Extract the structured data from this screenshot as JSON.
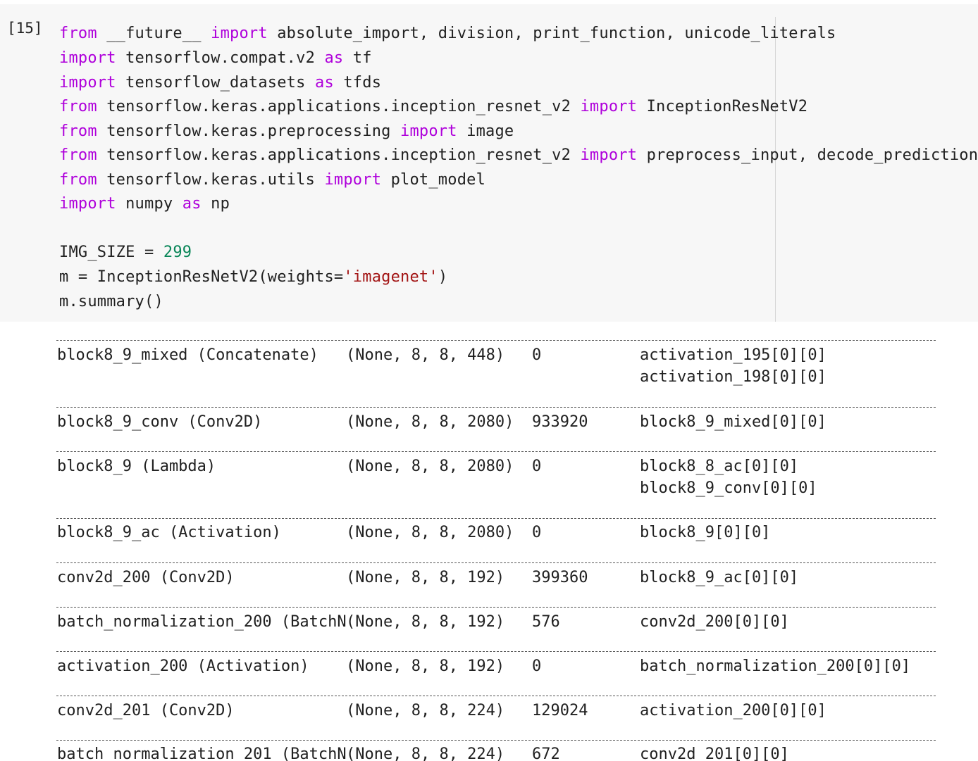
{
  "cell": {
    "execution_count": "[15]",
    "code_lines": [
      [
        {
          "t": "from",
          "c": "kw"
        },
        {
          "t": " __future__ ",
          "c": "plain"
        },
        {
          "t": "import",
          "c": "kw"
        },
        {
          "t": " absolute_import, division, print_function, unicode_literals",
          "c": "plain"
        }
      ],
      [
        {
          "t": "import",
          "c": "kw"
        },
        {
          "t": " tensorflow.compat.v2 ",
          "c": "plain"
        },
        {
          "t": "as",
          "c": "kw"
        },
        {
          "t": " tf",
          "c": "plain"
        }
      ],
      [
        {
          "t": "import",
          "c": "kw"
        },
        {
          "t": " tensorflow_datasets ",
          "c": "plain"
        },
        {
          "t": "as",
          "c": "kw"
        },
        {
          "t": " tfds",
          "c": "plain"
        }
      ],
      [
        {
          "t": "from",
          "c": "kw"
        },
        {
          "t": " tensorflow.keras.applications.inception_resnet_v2 ",
          "c": "plain"
        },
        {
          "t": "import",
          "c": "kw"
        },
        {
          "t": " InceptionResNetV2",
          "c": "plain"
        }
      ],
      [
        {
          "t": "from",
          "c": "kw"
        },
        {
          "t": " tensorflow.keras.preprocessing ",
          "c": "plain"
        },
        {
          "t": "import",
          "c": "kw"
        },
        {
          "t": " image",
          "c": "plain"
        }
      ],
      [
        {
          "t": "from",
          "c": "kw"
        },
        {
          "t": " tensorflow.keras.applications.inception_resnet_v2 ",
          "c": "plain"
        },
        {
          "t": "import",
          "c": "kw"
        },
        {
          "t": " preprocess_input, decode_predictions",
          "c": "plain"
        }
      ],
      [
        {
          "t": "from",
          "c": "kw"
        },
        {
          "t": " tensorflow.keras.utils ",
          "c": "plain"
        },
        {
          "t": "import",
          "c": "kw"
        },
        {
          "t": " plot_model",
          "c": "plain"
        }
      ],
      [
        {
          "t": "import",
          "c": "kw"
        },
        {
          "t": " numpy ",
          "c": "plain"
        },
        {
          "t": "as",
          "c": "kw"
        },
        {
          "t": " np",
          "c": "plain"
        }
      ],
      [],
      [
        {
          "t": "IMG_SIZE = ",
          "c": "plain"
        },
        {
          "t": "299",
          "c": "num"
        }
      ],
      [
        {
          "t": "m = InceptionResNetV2(weights=",
          "c": "plain"
        },
        {
          "t": "'imagenet'",
          "c": "str"
        },
        {
          "t": ")",
          "c": "plain"
        }
      ],
      [
        {
          "t": "m.summary()",
          "c": "plain"
        }
      ]
    ]
  },
  "output": {
    "rows": [
      {
        "layer": "block8_9_mixed (Concatenate)",
        "shape": "(None, 8, 8, 448)",
        "params": "0",
        "connected": [
          "activation_195[0][0]",
          "activation_198[0][0]"
        ]
      },
      {
        "layer": "block8_9_conv (Conv2D)",
        "shape": "(None, 8, 8, 2080)",
        "params": "933920",
        "connected": [
          "block8_9_mixed[0][0]"
        ]
      },
      {
        "layer": "block8_9 (Lambda)",
        "shape": "(None, 8, 8, 2080)",
        "params": "0",
        "connected": [
          "block8_8_ac[0][0]",
          "block8_9_conv[0][0]"
        ]
      },
      {
        "layer": "block8_9_ac (Activation)",
        "shape": "(None, 8, 8, 2080)",
        "params": "0",
        "connected": [
          "block8_9[0][0]"
        ]
      },
      {
        "layer": "conv2d_200 (Conv2D)",
        "shape": "(None, 8, 8, 192)",
        "params": "399360",
        "connected": [
          "block8_9_ac[0][0]"
        ]
      },
      {
        "layer": "batch_normalization_200 (BatchN",
        "shape": "(None, 8, 8, 192)",
        "params": "576",
        "connected": [
          "conv2d_200[0][0]"
        ]
      },
      {
        "layer": "activation_200 (Activation)",
        "shape": "(None, 8, 8, 192)",
        "params": "0",
        "connected": [
          "batch_normalization_200[0][0]"
        ]
      },
      {
        "layer": "conv2d_201 (Conv2D)",
        "shape": "(None, 8, 8, 224)",
        "params": "129024",
        "connected": [
          "activation_200[0][0]"
        ]
      },
      {
        "layer": "batch_normalization_201 (BatchN",
        "shape": "(None, 8, 8, 224)",
        "params": "672",
        "connected": [
          "conv2d_201[0][0]"
        ]
      }
    ]
  }
}
